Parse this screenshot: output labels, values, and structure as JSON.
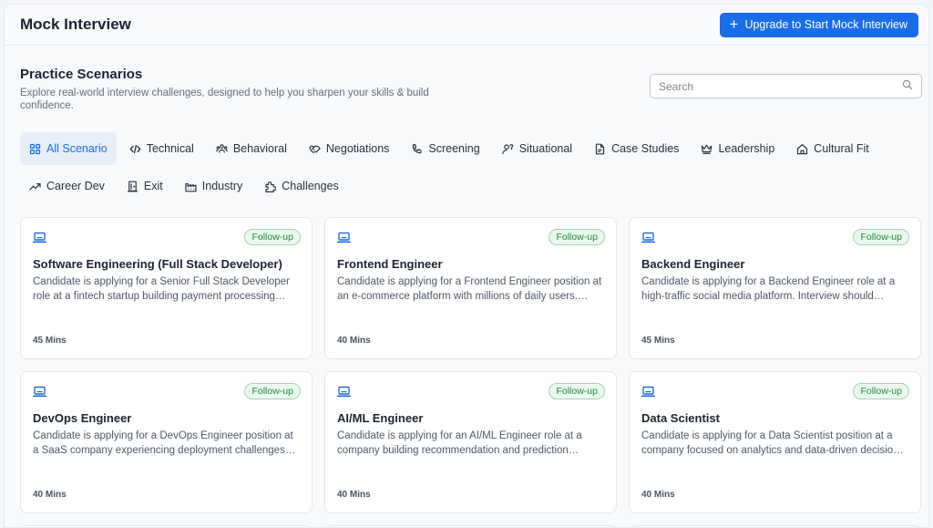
{
  "header": {
    "title": "Mock Interview",
    "upgrade_label": "Upgrade to Start Mock Interview",
    "upgrade_color": "#1a6de8"
  },
  "section": {
    "title": "Practice Scenarios",
    "subtitle": "Explore real-world interview challenges, designed to help you sharpen your skills & build confidence."
  },
  "search": {
    "placeholder": "Search",
    "value": "",
    "icon": "search-icon"
  },
  "categories": [
    {
      "label": "All Scenario",
      "icon": "grid-icon",
      "active": true
    },
    {
      "label": "Technical",
      "icon": "code-icon"
    },
    {
      "label": "Behavioral",
      "icon": "users-icon"
    },
    {
      "label": "Negotiations",
      "icon": "handshake-icon"
    },
    {
      "label": "Screening",
      "icon": "phone-icon"
    },
    {
      "label": "Situational",
      "icon": "person-question-icon"
    },
    {
      "label": "Case Studies",
      "icon": "document-icon"
    },
    {
      "label": "Leadership",
      "icon": "crown-icon"
    },
    {
      "label": "Cultural Fit",
      "icon": "home-icon"
    },
    {
      "label": "Career Dev",
      "icon": "trend-up-icon"
    },
    {
      "label": "Exit",
      "icon": "exit-door-icon"
    },
    {
      "label": "Industry",
      "icon": "factory-icon"
    },
    {
      "label": "Challenges",
      "icon": "puzzle-icon"
    }
  ],
  "cards": [
    {
      "title": "Software Engineering (Full Stack Developer)",
      "description": "Candidate is applying for a Senior Full Stack Developer role at a fintech startup building payment processing…",
      "duration": "45 Mins",
      "badge": "Follow-up"
    },
    {
      "title": "Frontend Engineer",
      "description": "Candidate is applying for a Frontend Engineer position at an e-commerce platform with millions of daily users.…",
      "duration": "40 Mins",
      "badge": "Follow-up"
    },
    {
      "title": "Backend Engineer",
      "description": "Candidate is applying for a Backend Engineer role at a high-traffic social media platform. Interview should…",
      "duration": "45 Mins",
      "badge": "Follow-up"
    },
    {
      "title": "DevOps Engineer",
      "description": "Candidate is applying for a DevOps Engineer position at a SaaS company experiencing deployment challenges…",
      "duration": "40 Mins",
      "badge": "Follow-up"
    },
    {
      "title": "AI/ML Engineer",
      "description": "Candidate is applying for an AI/ML Engineer role at a company building recommendation and prediction…",
      "duration": "40 Mins",
      "badge": "Follow-up"
    },
    {
      "title": "Data Scientist",
      "description": "Candidate is applying for a Data Scientist position at a company focused on analytics and data-driven decisio…",
      "duration": "40 Mins",
      "badge": "Follow-up"
    }
  ]
}
